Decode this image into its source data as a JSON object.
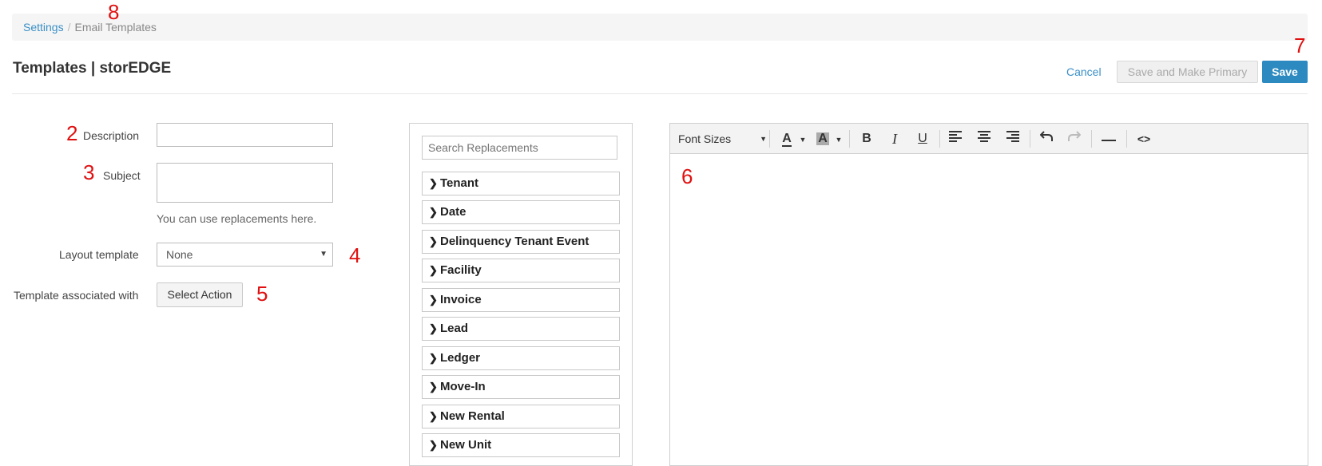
{
  "breadcrumb": {
    "root": "Settings",
    "separator": "/",
    "current": "Email Templates"
  },
  "page": {
    "title": "Templates | storEDGE"
  },
  "actions": {
    "cancel": "Cancel",
    "save_primary": "Save and Make Primary",
    "save": "Save"
  },
  "form": {
    "description_label": "Description",
    "description_value": "",
    "subject_label": "Subject",
    "subject_value": "",
    "subject_help": "You can use replacements here.",
    "layout_label": "Layout template",
    "layout_value": "None",
    "association_label": "Template associated with",
    "association_button": "Select Action"
  },
  "replacements": {
    "search_placeholder": "Search Replacements",
    "items": [
      "Tenant",
      "Date",
      "Delinquency Tenant Event",
      "Facility",
      "Invoice",
      "Lead",
      "Ledger",
      "Move-In",
      "New Rental",
      "New Unit"
    ]
  },
  "editor": {
    "font_sizes_label": "Font Sizes",
    "content": "",
    "toolbar_icons": [
      "text-color-icon",
      "background-color-icon",
      "bold-icon",
      "italic-icon",
      "underline-icon",
      "align-left-icon",
      "align-center-icon",
      "align-right-icon",
      "undo-icon",
      "redo-icon",
      "horizontal-rule-icon",
      "source-code-icon"
    ]
  },
  "annotations": {
    "description": "2",
    "subject": "3",
    "layout": "4",
    "association": "5",
    "editor": "6",
    "save": "7",
    "breadcrumb": "8"
  },
  "colors": {
    "accent": "#2d8ac0",
    "link": "#3a8fc7",
    "annotation": "#e01010"
  }
}
